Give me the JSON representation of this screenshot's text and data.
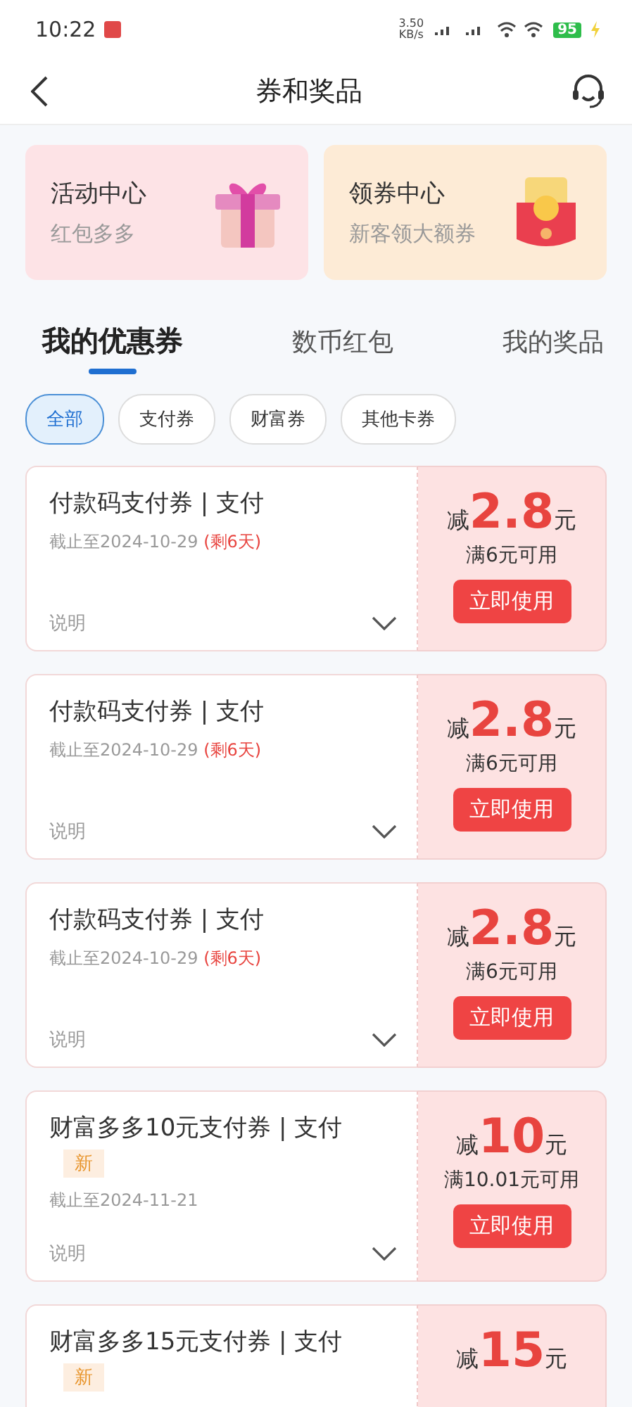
{
  "status_bar": {
    "time": "10:22",
    "speed": "3.50",
    "speed_unit": "KB/s",
    "battery": "95"
  },
  "header": {
    "title": "券和奖品"
  },
  "promo_cards": [
    {
      "title": "活动中心",
      "subtitle": "红包多多",
      "kind": "gift"
    },
    {
      "title": "领券中心",
      "subtitle": "新客领大额券",
      "kind": "envelope"
    }
  ],
  "tabs": [
    {
      "label": "我的优惠券",
      "selected": true
    },
    {
      "label": "数币红包",
      "selected": false
    },
    {
      "label": "我的奖品",
      "selected": false
    }
  ],
  "filters": [
    {
      "label": "全部",
      "selected": true
    },
    {
      "label": "支付券",
      "selected": false
    },
    {
      "label": "财富券",
      "selected": false
    },
    {
      "label": "其他卡券",
      "selected": false
    }
  ],
  "coupons": [
    {
      "title": "付款码支付券 | 支付",
      "is_new": false,
      "deadline": "截止至2024-10-29",
      "remaining": "(剩6天)",
      "note": "说明",
      "prefix": "减",
      "amount": "2.8",
      "unit": "元",
      "condition": "满6元可用",
      "button": "立即使用"
    },
    {
      "title": "付款码支付券 | 支付",
      "is_new": false,
      "deadline": "截止至2024-10-29",
      "remaining": "(剩6天)",
      "note": "说明",
      "prefix": "减",
      "amount": "2.8",
      "unit": "元",
      "condition": "满6元可用",
      "button": "立即使用"
    },
    {
      "title": "付款码支付券 | 支付",
      "is_new": false,
      "deadline": "截止至2024-10-29",
      "remaining": "(剩6天)",
      "note": "说明",
      "prefix": "减",
      "amount": "2.8",
      "unit": "元",
      "condition": "满6元可用",
      "button": "立即使用"
    },
    {
      "title": "财富多多10元支付券 | 支付",
      "is_new": true,
      "new_label": "新",
      "deadline": "截止至2024-11-21",
      "note": "说明",
      "prefix": "减",
      "amount": "10",
      "unit": "元",
      "condition": "满10.01元可用",
      "button": "立即使用"
    },
    {
      "title": "财富多多15元支付券 | 支付",
      "is_new": true,
      "new_label": "新",
      "prefix": "减",
      "amount": "15",
      "unit": "元"
    }
  ]
}
